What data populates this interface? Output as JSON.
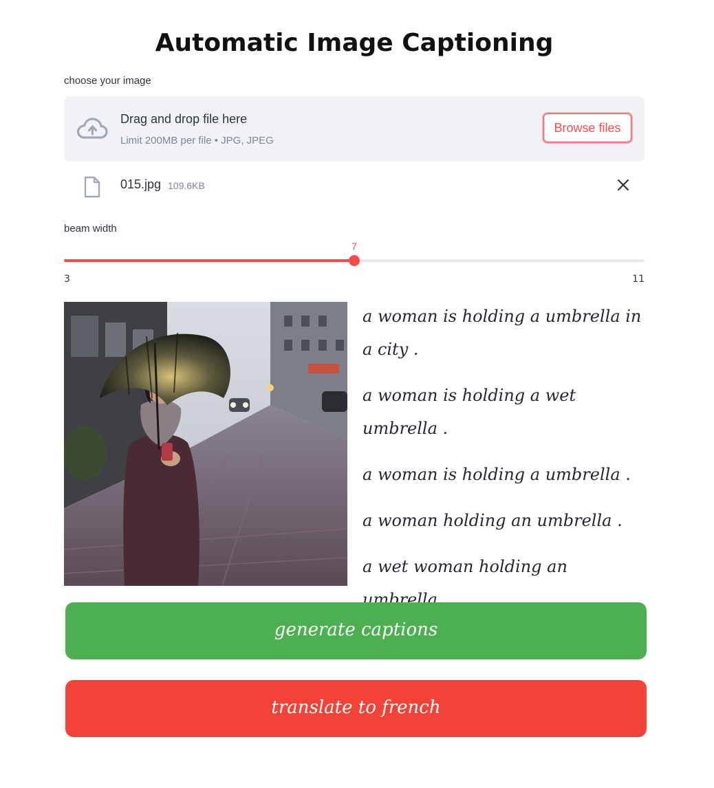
{
  "header": {
    "title": "Automatic Image Captioning"
  },
  "uploader": {
    "label": "choose your image",
    "drop_text": "Drag and drop file here",
    "limit_text": "Limit 200MB per file • JPG, JPEG",
    "browse_label": "Browse files",
    "file": {
      "name": "015.jpg",
      "size": "109.6KB"
    }
  },
  "slider": {
    "label": "beam width",
    "min": 3,
    "max": 11,
    "value": 7,
    "min_label": "3",
    "max_label": "11",
    "value_label": "7"
  },
  "captions": [
    "a woman is holding a umbrella in a city .",
    "a woman is holding a wet umbrella .",
    "a woman is holding a umbrella .",
    "a woman holding an umbrella .",
    "a wet woman holding an umbrella ."
  ],
  "buttons": {
    "generate": "generate captions",
    "translate": "translate to french"
  },
  "colors": {
    "accent": "#ff4b4b",
    "generate_bg": "#4caf50",
    "translate_bg": "#f44336",
    "dropzone_bg": "#f0f2f6"
  },
  "icons": {
    "upload": "cloud-upload-icon",
    "file": "file-icon",
    "close": "close-icon"
  }
}
